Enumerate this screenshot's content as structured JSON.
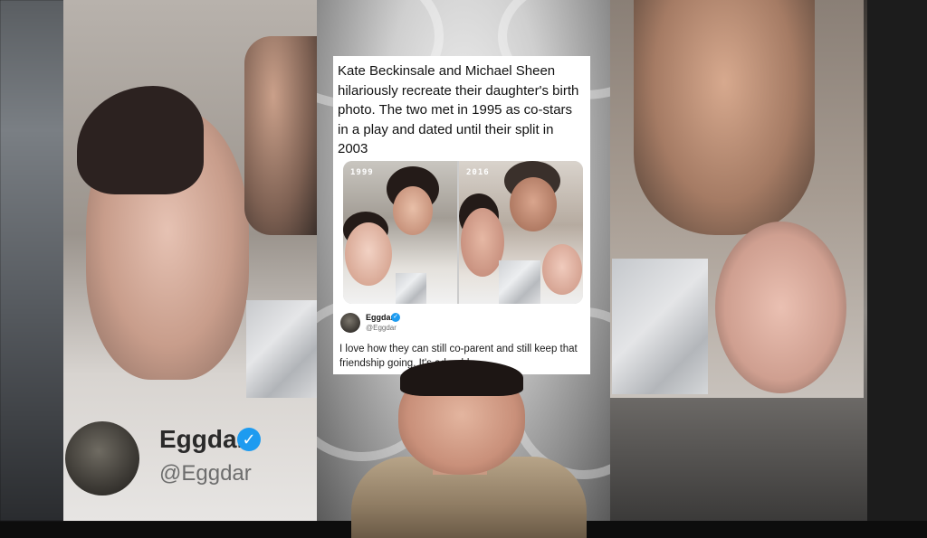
{
  "post": {
    "text": "Kate Beckinsale and Michael Sheen hilariously recreate their daughter's birth photo. The two met in 1995 as co-stars in a play and dated until their split in 2003",
    "photo_labels": [
      "1999",
      "2016"
    ]
  },
  "reply": {
    "author_name": "Eggdar",
    "author_handle": "@Eggdar",
    "text": "I love how they can still co-parent and still keep that friendship going. It's adorable.",
    "verified_icon": "check-badge-icon"
  },
  "background": {
    "author_name": "Eggdar",
    "author_handle": "@Eggdar"
  },
  "colors": {
    "verified_blue": "#1d9bf0",
    "card_bg": "#ffffff"
  }
}
